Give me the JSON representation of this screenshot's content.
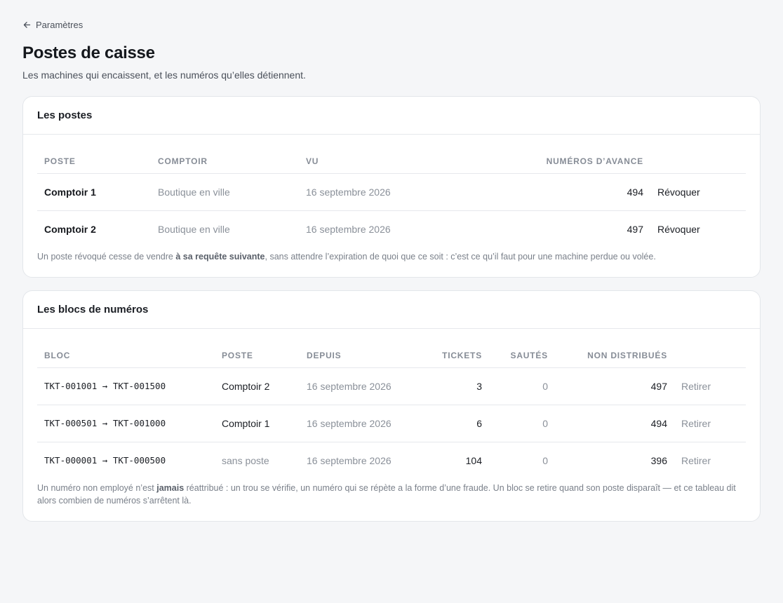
{
  "nav": {
    "back_label": "Paramètres"
  },
  "header": {
    "title": "Postes de caisse",
    "subtitle": "Les machines qui encaissent, et les numéros qu’elles détiennent."
  },
  "postes": {
    "title": "Les postes",
    "columns": [
      "Poste",
      "Comptoir",
      "Vu",
      "Numéros d’avance"
    ],
    "rows": [
      {
        "poste": "Comptoir 1",
        "comptoir": "Boutique en ville",
        "vu": "16 septembre 2026",
        "avance": "494",
        "action": "Révoquer"
      },
      {
        "poste": "Comptoir 2",
        "comptoir": "Boutique en ville",
        "vu": "16 septembre 2026",
        "avance": "497",
        "action": "Révoquer"
      }
    ],
    "note_before": "Un poste révoqué cesse de vendre ",
    "note_bold": "à sa requête suivante",
    "note_after": ", sans attendre l’expiration de quoi que ce soit : c’est ce qu’il faut pour une machine perdue ou volée."
  },
  "blocs": {
    "title": "Les blocs de numéros",
    "columns": [
      "Bloc",
      "Poste",
      "Depuis",
      "Tickets",
      "Sautés",
      "Non distribués"
    ],
    "rows": [
      {
        "bloc": "TKT-001001 → TKT-001500",
        "poste": "Comptoir 2",
        "poste_muted": false,
        "depuis": "16 septembre 2026",
        "tickets": "3",
        "sautes": "0",
        "non_distribues": "497",
        "action": "Retirer"
      },
      {
        "bloc": "TKT-000501 → TKT-001000",
        "poste": "Comptoir 1",
        "poste_muted": false,
        "depuis": "16 septembre 2026",
        "tickets": "6",
        "sautes": "0",
        "non_distribues": "494",
        "action": "Retirer"
      },
      {
        "bloc": "TKT-000001 → TKT-000500",
        "poste": "sans poste",
        "poste_muted": true,
        "depuis": "16 septembre 2026",
        "tickets": "104",
        "sautes": "0",
        "non_distribues": "396",
        "action": "Retirer"
      }
    ],
    "note_before": "Un numéro non employé n’est ",
    "note_bold": "jamais",
    "note_after": " réattribué : un trou se vérifie, un numéro qui se répète a la forme d’une fraude. Un bloc se retire quand son poste disparaît — et ce tableau dit alors combien de numéros s’arrêtent là."
  }
}
